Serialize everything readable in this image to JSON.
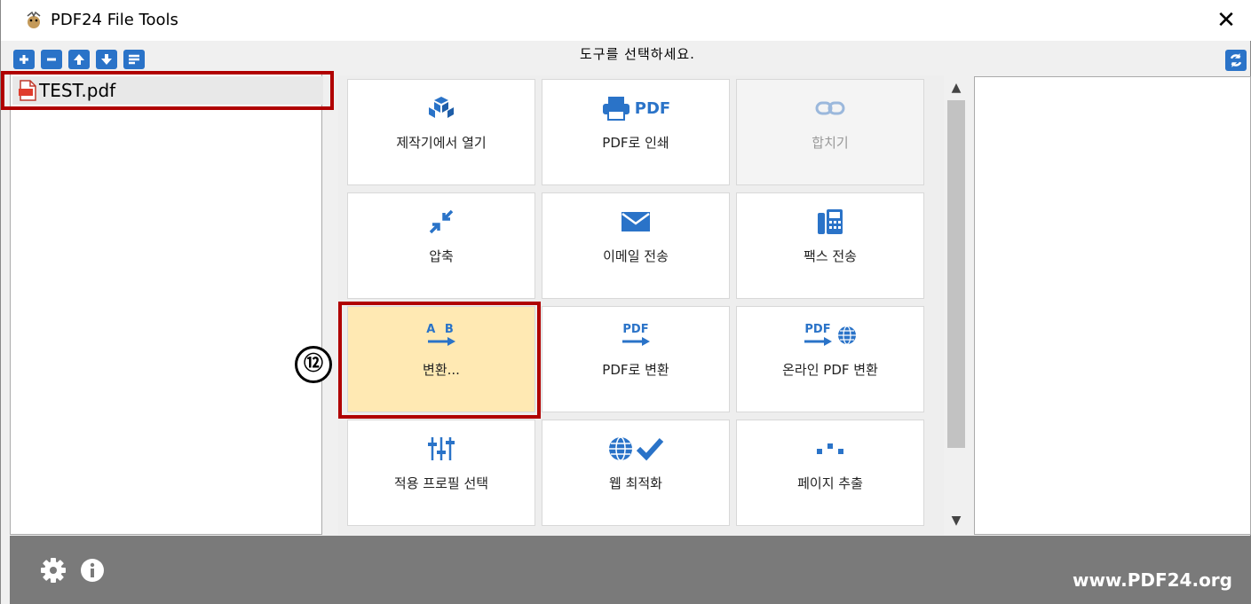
{
  "window": {
    "title": "PDF24 File Tools",
    "close": "✕"
  },
  "toolbar": {
    "hint": "도구를 선택하세요."
  },
  "files": [
    {
      "name": "TEST.pdf"
    }
  ],
  "tools": [
    {
      "label": "제작기에서 열기",
      "icon": "creator-icon"
    },
    {
      "label": "PDF로 인쇄",
      "icon": "printer-pdf-icon",
      "icon_text": "PDF"
    },
    {
      "label": "합치기",
      "icon": "link-icon",
      "disabled": true
    },
    {
      "label": "압축",
      "icon": "compress-icon"
    },
    {
      "label": "이메일 전송",
      "icon": "envelope-icon"
    },
    {
      "label": "팩스 전송",
      "icon": "fax-icon"
    },
    {
      "label": "변환...",
      "icon": "convert-ab-icon",
      "icon_text": "A B",
      "selected": true
    },
    {
      "label": "PDF로 변환",
      "icon": "convert-pdf-icon",
      "icon_text": "PDF"
    },
    {
      "label": "온라인 PDF 변환",
      "icon": "online-convert-icon",
      "icon_text": "PDF"
    },
    {
      "label": "적용 프로필 선택",
      "icon": "sliders-icon"
    },
    {
      "label": "웹 최적화",
      "icon": "web-check-icon"
    },
    {
      "label": "페이지 추출",
      "icon": "extract-pages-icon"
    }
  ],
  "annotation": {
    "badge": "⑫"
  },
  "footer": {
    "site": "www.PDF24.org"
  },
  "colors": {
    "accent": "#2a73c8",
    "selected": "#ffe9b3",
    "highlight": "#b00000",
    "footer": "#7a7a7a"
  }
}
